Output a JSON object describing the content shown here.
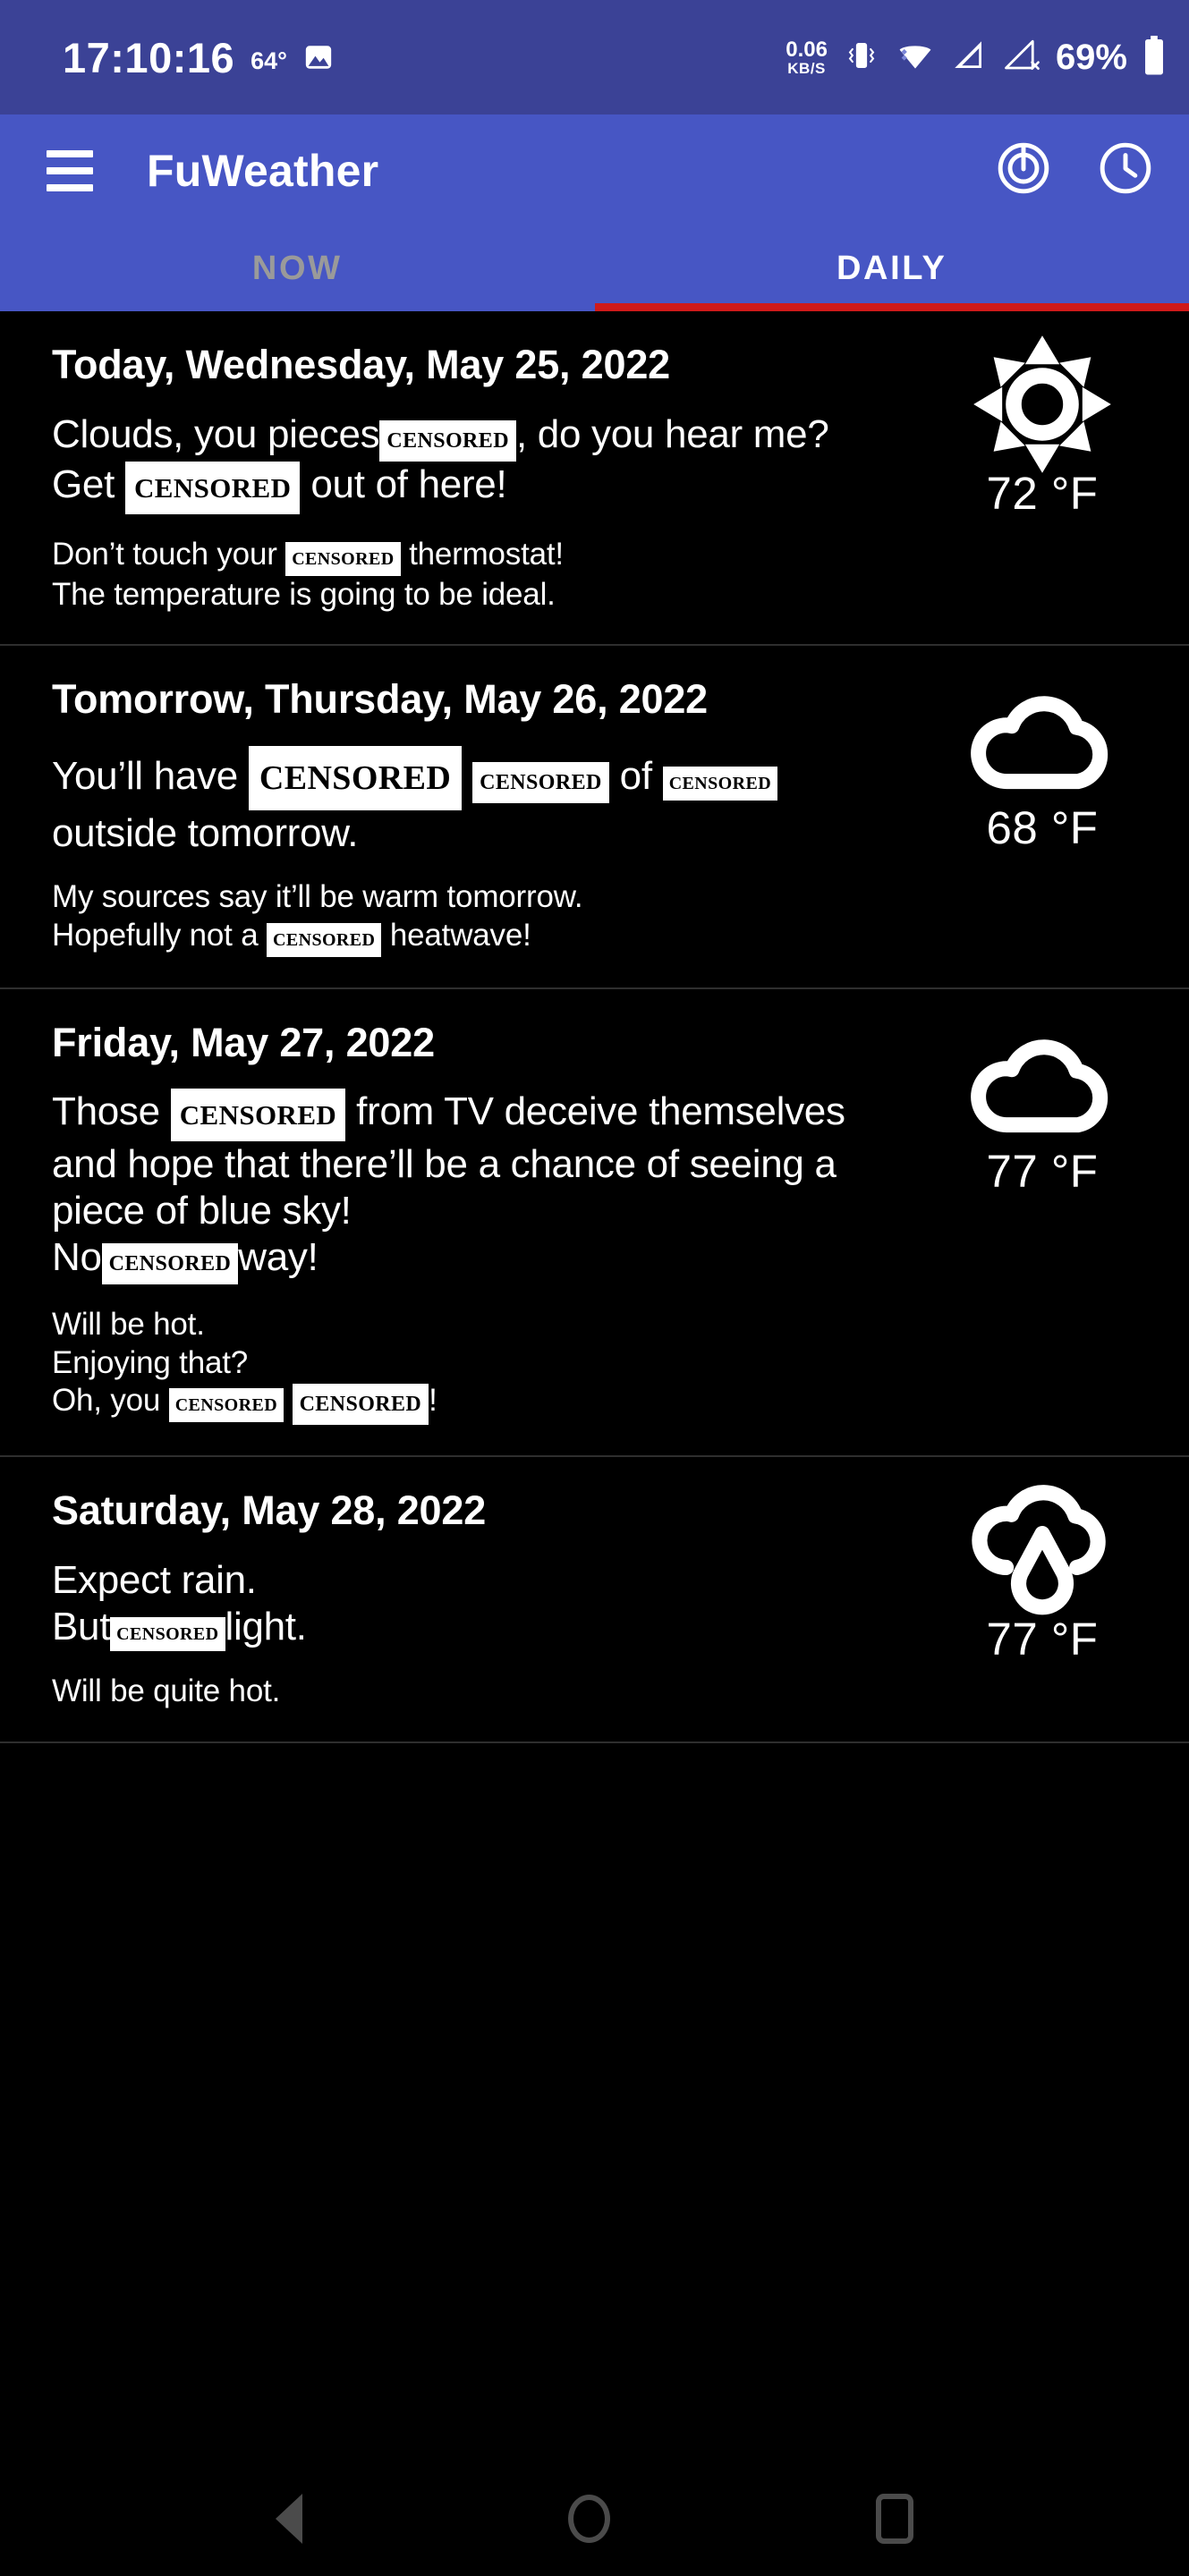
{
  "status_bar": {
    "clock": "17:10:16",
    "temperature": "64°",
    "photo_icon": "image-icon",
    "data_rate_value": "0.06",
    "data_rate_unit": "KB/S",
    "vibrate_icon": "vibrate-icon",
    "wifi_icon": "wifi-icon",
    "signal_icon": "cellular-signal-icon",
    "signal_off_icon": "cellular-signal-off-icon",
    "battery_percent": "69%",
    "battery_icon": "battery-icon",
    "background_color": "#3b4296"
  },
  "app_bar": {
    "menu_icon": "hamburger-menu-icon",
    "title": "FuWeather",
    "refresh_icon": "power-refresh-icon",
    "clock_icon": "clock-icon",
    "background_color": "#4756c4"
  },
  "tabs": {
    "items": [
      {
        "label": "NOW",
        "active": false
      },
      {
        "label": "DAILY",
        "active": true
      }
    ],
    "indicator_color": "#cf1a1a",
    "active_color": "#ffffff",
    "inactive_color": "#9a9a9a"
  },
  "forecast": {
    "cards": [
      {
        "date": "Today, Wednesday, May 25, 2022",
        "summary_line_1_pre": "Clouds, you pieces",
        "summary_line_1_chip": "CENSORED",
        "summary_line_1_post": ", do you hear me?",
        "summary_line_2_pre": "Get",
        "summary_line_2_chip": "CENSORED",
        "summary_line_2_post": "out of here!",
        "detail_line_1_pre": "Don’t touch your",
        "detail_line_1_chip": "CENSORED",
        "detail_line_1_post": "thermostat!",
        "detail_line_2": "The temperature is going to be ideal.",
        "icon": "sun-icon",
        "temperature": "72 °F"
      },
      {
        "date": "Tomorrow, Thursday, May 26, 2022",
        "summary_pre": "You’ll have",
        "summary_chip_1": "CENSORED",
        "summary_chip_2": "CENSORED",
        "summary_mid": "of",
        "summary_chip_3": "CENSORED",
        "summary_post": "outside tomorrow.",
        "detail_line_1": "My sources say it’ll be warm tomorrow.",
        "detail_line_2_pre": "Hopefully not a",
        "detail_line_2_chip": "CENSORED",
        "detail_line_2_post": "heatwave!",
        "icon": "cloud-icon",
        "temperature": "68 °F"
      },
      {
        "date": "Friday, May 27, 2022",
        "summary_pre": "Those",
        "summary_chip_1": "CENSORED",
        "summary_post": "from TV deceive themselves and hope that there’ll be a chance of seeing a piece of blue sky!",
        "summary_line_2_pre": "No",
        "summary_line_2_chip": "CENSORED",
        "summary_line_2_post": "way!",
        "detail_line_1": "Will be hot.",
        "detail_line_2": "Enjoying that?",
        "detail_line_3_pre": "Oh, you",
        "detail_line_3_chip_1": "CENSORED",
        "detail_line_3_chip_2": "CENSORED",
        "detail_line_3_post": "!",
        "icon": "cloud-icon",
        "temperature": "77 °F"
      },
      {
        "date": "Saturday, May 28, 2022",
        "summary_line_1": "Expect rain.",
        "summary_line_2_pre": "But",
        "summary_line_2_chip": "CENSORED",
        "summary_line_2_post": "light.",
        "detail_line_1": "Will be quite hot.",
        "icon": "rain-icon",
        "temperature": "77 °F"
      }
    ]
  },
  "nav_bar": {
    "back_icon": "back-triangle-icon",
    "home_icon": "home-circle-icon",
    "recent_icon": "recent-apps-square-icon"
  }
}
